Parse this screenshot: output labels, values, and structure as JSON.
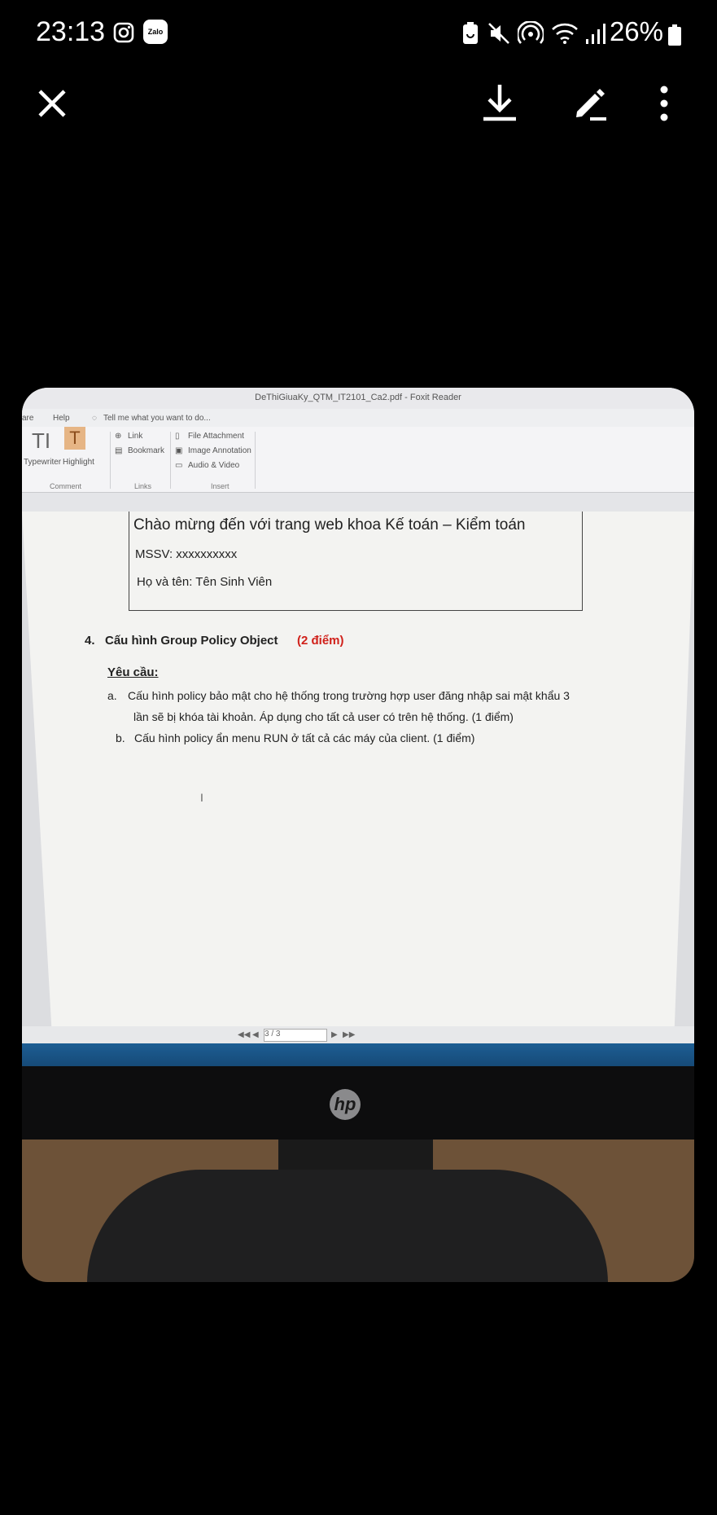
{
  "status_bar": {
    "time": "23:13",
    "battery": "26%",
    "icons": [
      "instagram-icon",
      "zalo-icon",
      "battery-saver-icon",
      "mute-icon",
      "hotspot-icon",
      "wifi-icon",
      "signal-icon",
      "battery-icon"
    ],
    "zalo_label": "Zalo"
  },
  "actions": {
    "close_icon": "close-icon",
    "download_icon": "download-icon",
    "edit_icon": "edit-icon",
    "more_icon": "more-vert-icon"
  },
  "photo": {
    "window_title": "DeThiGiuaKy_QTM_IT2101_Ca2.pdf - Foxit Reader",
    "menu": {
      "share": "are",
      "help": "Help",
      "tell_me": "Tell me what you want to do..."
    },
    "ribbon": {
      "typewriter": "Typewriter",
      "highlight": "Highlight",
      "link": "Link",
      "bookmark": "Bookmark",
      "file_attachment": "File Attachment",
      "image_annotation": "Image Annotation",
      "audio_video": "Audio & Video",
      "group_comment": "Comment",
      "group_links": "Links",
      "group_insert": "Insert"
    },
    "document": {
      "welcome": "Chào mừng đến với trang web khoa Kế toán – Kiểm toán",
      "mssv": "MSSV: xxxxxxxxxx",
      "name": "Họ và tên: Tên Sinh Viên",
      "q4_number": "4.",
      "q4_title": "Cấu hình Group Policy Object",
      "q4_points": "(2 điểm)",
      "requirement": "Yêu cầu:",
      "item_a_label": "a.",
      "item_a_line1": "Cấu hình policy bảo mật cho hệ thống trong trường hợp user đăng nhập sai mật khẩu 3",
      "item_a_line2": "lần sẽ bị khóa tài khoản. Áp dụng cho tất cả user có trên hệ thống. (1 điểm)",
      "item_b_label": "b.",
      "item_b_line": "Cấu hình policy ẩn menu RUN ở tất cả các máy của client. (1 điểm)"
    },
    "page_nav": "3 / 3",
    "monitor_brand": "hp"
  },
  "colors": {
    "points_red": "#d0201a",
    "background": "#000000"
  }
}
